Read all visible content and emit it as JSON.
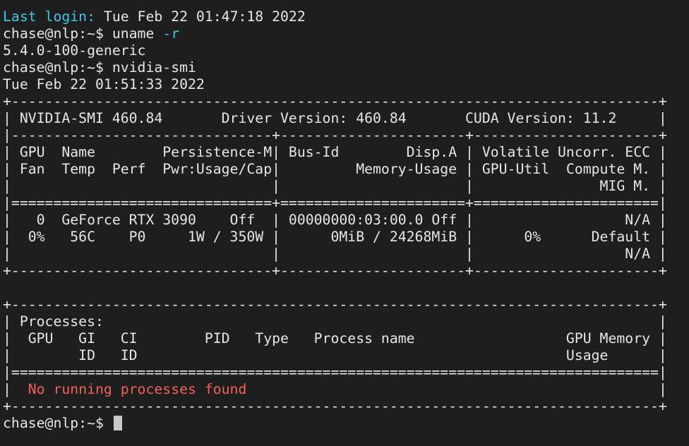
{
  "terminal": {
    "login": {
      "label": "Last login:",
      "value": " Tue Feb 22 01:47:18 2022"
    },
    "cmd1": {
      "prompt": "chase@nlp:~$ ",
      "command": "uname",
      "flag": " -r"
    },
    "kernel": "5.4.0-100-generic",
    "cmd2": {
      "prompt": "chase@nlp:~$ ",
      "command": "nvidia-smi"
    },
    "date": "Tue Feb 22 01:51:33 2022",
    "smi_lines": [
      "+-----------------------------------------------------------------------------+",
      "| NVIDIA-SMI 460.84       Driver Version: 460.84       CUDA Version: 11.2     |",
      "|-------------------------------+----------------------+----------------------+",
      "| GPU  Name        Persistence-M| Bus-Id        Disp.A | Volatile Uncorr. ECC |",
      "| Fan  Temp  Perf  Pwr:Usage/Cap|         Memory-Usage | GPU-Util  Compute M. |",
      "|                               |                      |               MIG M. |",
      "|===============================+======================+======================|",
      "|   0  GeForce RTX 3090    Off  | 00000000:03:00.0 Off |                  N/A |",
      "|  0%   56C    P0     1W / 350W |      0MiB / 24268MiB |      0%      Default |",
      "|                               |                      |                  N/A |",
      "+-------------------------------+----------------------+----------------------+",
      "",
      "+-----------------------------------------------------------------------------+",
      "| Processes:                                                                  |",
      "|  GPU   GI   CI        PID   Type   Process name                  GPU Memory |",
      "|        ID   ID                                                   Usage      |",
      "|=============================================================================|"
    ],
    "no_proc": {
      "pre": "|  ",
      "message": "No running processes found",
      "post": "                                                 |"
    },
    "bottom_border": "+-----------------------------------------------------------------------------+",
    "final_prompt": "chase@nlp:~$ ",
    "colors": {
      "background": "#1e1e1e",
      "text": "#e6e6e6",
      "accent": "#3ec8e8",
      "error": "#f0625a",
      "cursor": "#c8c8c8"
    }
  }
}
